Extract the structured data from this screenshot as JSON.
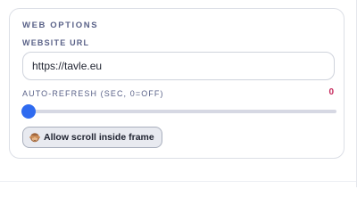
{
  "web_options": {
    "section_title": "WEB OPTIONS",
    "website_url": {
      "label": "WEBSITE URL",
      "value": "https://tavle.eu"
    },
    "auto_refresh": {
      "label": "AUTO-REFRESH (SEC, 0=OFF)",
      "value": "0",
      "min": 0,
      "level_fraction": 0
    },
    "scroll_button": {
      "icon": "see-no-evil-monkey-icon",
      "label": "Allow scroll inside frame"
    }
  },
  "colors": {
    "accent": "#2f6bf0",
    "value_highlight": "#c5265a",
    "label": "#5a6288"
  }
}
